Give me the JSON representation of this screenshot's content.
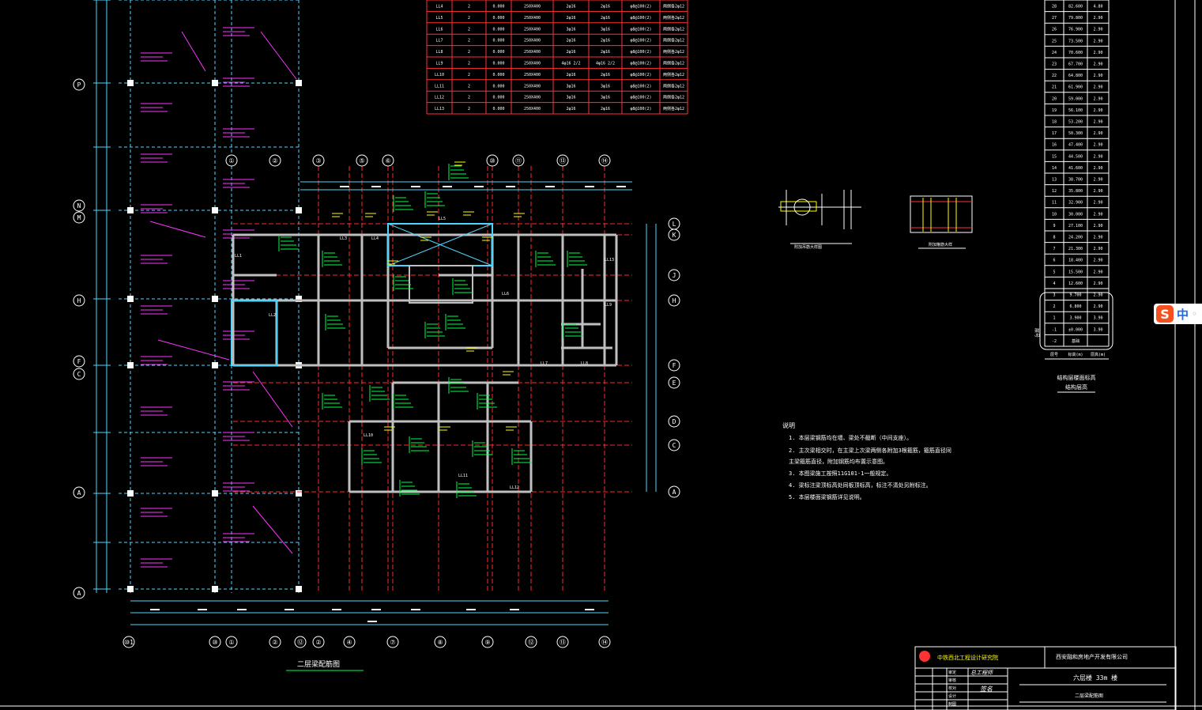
{
  "drawing": {
    "plan_title": "二层梁配筋图",
    "notes_title": "说明",
    "notes": [
      "1. 本层梁钢筋均在墙、梁处不截断（中间支座）。",
      "2. 主次梁相交时，在主梁上次梁两侧各附加3根箍筋，箍筋直径同",
      "   主梁箍筋直径，附加钢筋均布置示意图。",
      "3. 本图梁施工按照11G101-1一般规定。",
      "4. 梁标注梁顶标高处同板顶标高，标注不清处另附标注。",
      "5. 本层楼面梁钢筋详见说明。"
    ],
    "detail_1_label": "附加吊筋大样图",
    "detail_2_label": "附加箍筋大样",
    "floor_table_caption": "结构层楼面标高",
    "floor_table_sub": "结构层高"
  },
  "axes": {
    "top": [
      "①",
      "②",
      "③",
      "⑤",
      "⑥",
      "⑩",
      "⑪",
      "⑬",
      "⑭"
    ],
    "bottom": [
      "⑩1",
      "⑩",
      "①",
      "②",
      "⑫",
      "②",
      "④",
      "⑦",
      "⑧",
      "⑨",
      "⑫",
      "⑬",
      "⑭"
    ],
    "left": [
      "P",
      "N",
      "M",
      "H",
      "F",
      "C",
      "A",
      "A"
    ],
    "right": [
      "L",
      "K",
      "J",
      "H",
      "F",
      "E",
      "D",
      "C",
      "A"
    ]
  },
  "beam_table": {
    "rows": [
      [
        "LL4",
        "2",
        "0.000",
        "250X400",
        "2φ16",
        "2φ16",
        "φ8@100(2)",
        "两侧各2φ12"
      ],
      [
        "LL5",
        "2",
        "0.000",
        "250X400",
        "2φ16",
        "2φ16",
        "φ8@100(2)",
        "两侧各2φ12"
      ],
      [
        "LL6",
        "2",
        "0.000",
        "250X400",
        "3φ16",
        "3φ16",
        "φ8@100(2)",
        "两侧各2φ12"
      ],
      [
        "LL7",
        "2",
        "0.000",
        "250X400",
        "2φ16",
        "2φ16",
        "φ8@100(2)",
        "两侧各2φ12"
      ],
      [
        "LL8",
        "2",
        "0.000",
        "250X400",
        "2φ16",
        "2φ16",
        "φ8@100(2)",
        "两侧各2φ12"
      ],
      [
        "LL9",
        "2",
        "0.000",
        "250X400",
        "4φ16 2/2",
        "4φ16 2/2",
        "φ8@100(2)",
        "两侧各2φ12"
      ],
      [
        "LL10",
        "2",
        "0.000",
        "250X400",
        "2φ16",
        "2φ16",
        "φ8@100(2)",
        "两侧各2φ12"
      ],
      [
        "LL11",
        "2",
        "0.000",
        "250X400",
        "3φ16",
        "3φ16",
        "φ8@100(2)",
        "两侧各2φ12"
      ],
      [
        "LL12",
        "2",
        "0.000",
        "250X400",
        "3φ16",
        "3φ16",
        "φ8@100(2)",
        "两侧各2φ12"
      ],
      [
        "LL13",
        "2",
        "0.000",
        "250X400",
        "2φ16",
        "2φ16",
        "φ8@100(2)",
        "两侧各2φ12"
      ]
    ]
  },
  "floor_table": {
    "rows": [
      [
        "28",
        "82.600",
        "4.80"
      ],
      [
        "27",
        "79.800",
        "2.90"
      ],
      [
        "26",
        "76.900",
        "2.90"
      ],
      [
        "25",
        "73.500",
        "2.90"
      ],
      [
        "24",
        "70.600",
        "2.90"
      ],
      [
        "23",
        "67.700",
        "2.90"
      ],
      [
        "22",
        "64.800",
        "2.90"
      ],
      [
        "21",
        "61.900",
        "2.90"
      ],
      [
        "20",
        "59.000",
        "2.90"
      ],
      [
        "19",
        "56.100",
        "2.90"
      ],
      [
        "18",
        "53.200",
        "2.90"
      ],
      [
        "17",
        "50.300",
        "2.90"
      ],
      [
        "16",
        "47.400",
        "2.90"
      ],
      [
        "15",
        "44.500",
        "2.90"
      ],
      [
        "14",
        "41.600",
        "2.90"
      ],
      [
        "13",
        "38.700",
        "2.90"
      ],
      [
        "12",
        "35.800",
        "2.90"
      ],
      [
        "11",
        "32.900",
        "2.90"
      ],
      [
        "10",
        "30.000",
        "2.90"
      ],
      [
        "9",
        "27.100",
        "2.90"
      ],
      [
        "8",
        "24.200",
        "2.90"
      ],
      [
        "7",
        "21.300",
        "2.90"
      ],
      [
        "6",
        "18.400",
        "2.90"
      ],
      [
        "5",
        "15.500",
        "2.90"
      ],
      [
        "4",
        "12.600",
        "2.90"
      ],
      [
        "3",
        "9.700",
        "2.90"
      ],
      [
        "2",
        "6.800",
        "2.90"
      ],
      [
        "1",
        "3.900",
        "3.90"
      ],
      [
        "-1",
        "±0.000",
        "3.90"
      ],
      [
        "-2",
        "基础",
        ""
      ]
    ],
    "col_headers": [
      "层号",
      "标高(m)",
      "层高(m)"
    ]
  },
  "title_block": {
    "institute": "中铁西北工程设计研究院",
    "client": "西安融和房地产开发有限公司",
    "project": "六层楼 33m 楼",
    "sheet": "二层梁配筋图",
    "labels": [
      "审定",
      "审核",
      "校对",
      "设计",
      "制图"
    ],
    "sign_1": "总工程师",
    "sign_2": "签名"
  },
  "ime": {
    "lang": "中",
    "logo": "S"
  },
  "colors": {
    "background": "#000000",
    "axis_line": "#ff2a2a",
    "wall": "#bfbfbf",
    "column": "#5aa9ff",
    "beam_annot": "#00ff44",
    "magenta": "#ff33ff",
    "yellow": "#ffff00",
    "cyan": "#4cd6ff",
    "table_red": "#ff3333"
  }
}
